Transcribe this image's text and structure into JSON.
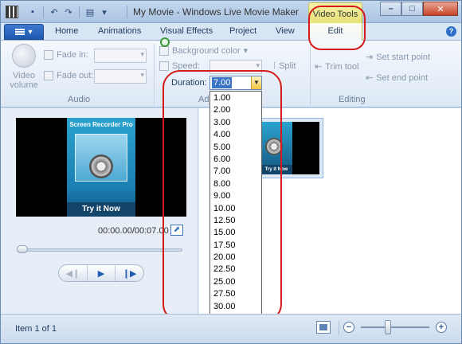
{
  "window": {
    "title": "My Movie - Windows Live Movie Maker",
    "context_tab_header": "Video Tools",
    "controls": {
      "minimize": "–",
      "maximize": "□",
      "close": "✕"
    }
  },
  "quick_access": {
    "icons": [
      "save-icon",
      "undo-icon",
      "redo-icon",
      "new-icon",
      "customize-icon"
    ],
    "glyphs": [
      "▪",
      "↶",
      "↷",
      "▤",
      "▾"
    ]
  },
  "tabs": {
    "file": "",
    "items": [
      "Home",
      "Animations",
      "Visual Effects",
      "Project",
      "View"
    ],
    "active": "Edit",
    "help": "?"
  },
  "ribbon": {
    "audio": {
      "label": "Audio",
      "video_volume": "Video volume",
      "fade_in": "Fade in:",
      "fade_out": "Fade out:"
    },
    "adjust": {
      "label": "Adj",
      "background_color": "Background color",
      "speed": "Speed:",
      "duration": "Duration:",
      "duration_value": "7.00",
      "split": "Split"
    },
    "editing": {
      "label": "Editing",
      "trim_tool": "Trim tool",
      "set_start_point": "Set start point",
      "set_end_point": "Set end point"
    }
  },
  "duration_options": [
    "1.00",
    "2.00",
    "3.00",
    "4.00",
    "5.00",
    "6.00",
    "7.00",
    "8.00",
    "9.00",
    "10.00",
    "12.50",
    "15.00",
    "17.50",
    "20.00",
    "22.50",
    "25.00",
    "27.50",
    "30.00"
  ],
  "preview": {
    "thumbnail_title": "Screen Recorder Pro",
    "thumbnail_cta": "Try it Now",
    "timecode": "00:00.00/00:07.00",
    "seek_position": 0.0
  },
  "storyboard": {
    "clip_cta": "Try it Now"
  },
  "status": {
    "item_text": "Item 1 of 1",
    "zoom_level": 0.4
  },
  "annotation_color": "#d41a1a"
}
